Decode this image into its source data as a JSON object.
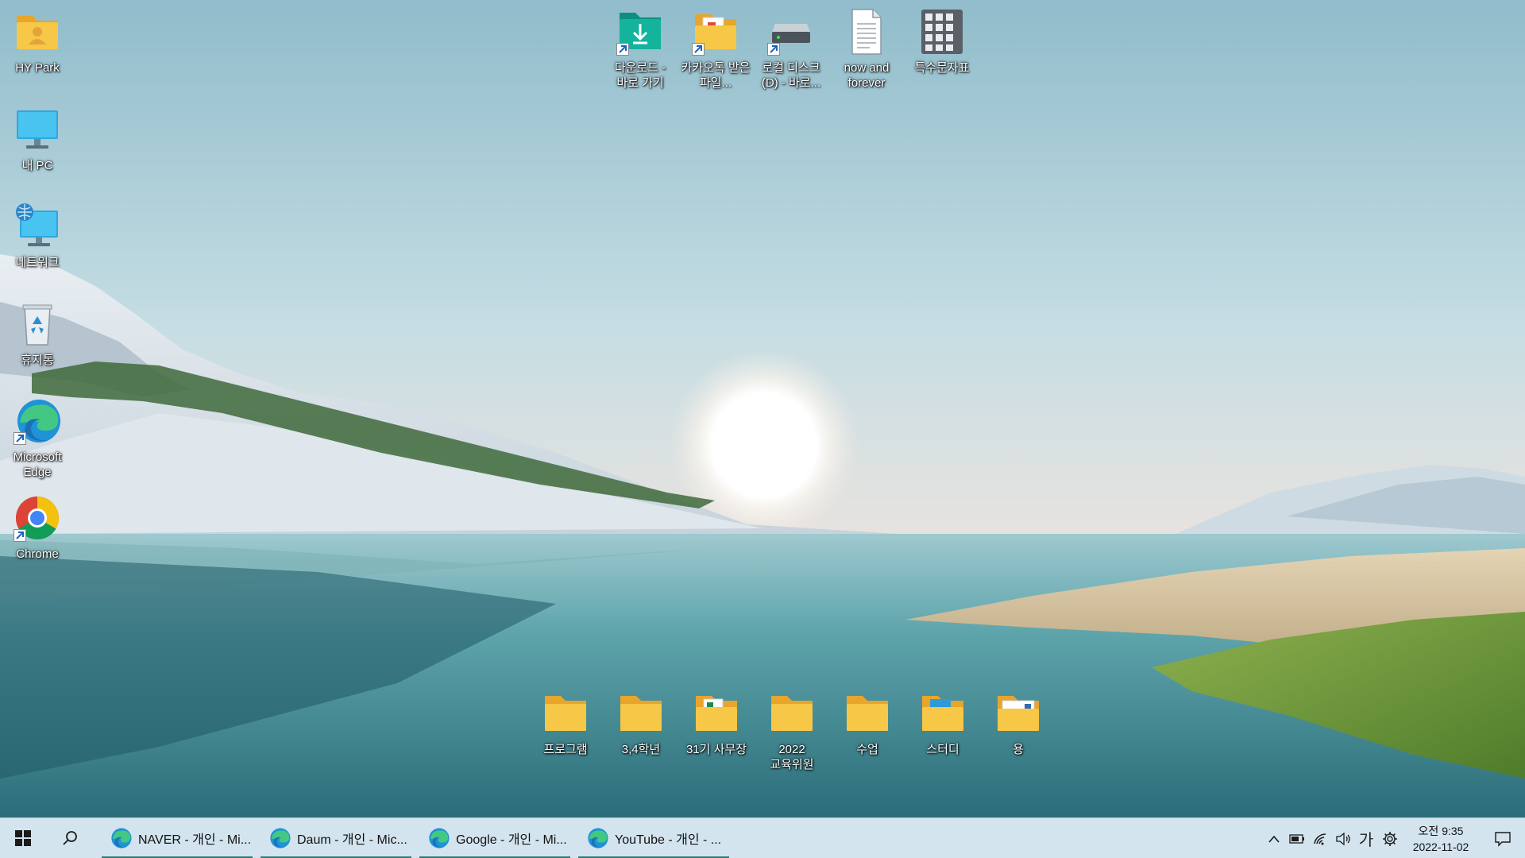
{
  "desktop": {
    "left_column": [
      {
        "name": "user-folder",
        "label": "HY Park",
        "icon": "user-folder-icon"
      },
      {
        "name": "this-pc",
        "label": "내 PC",
        "icon": "monitor-icon"
      },
      {
        "name": "network",
        "label": "네트워크",
        "icon": "network-icon"
      },
      {
        "name": "recycle-bin",
        "label": "휴지통",
        "icon": "recycle-bin-icon"
      },
      {
        "name": "edge",
        "label": "Microsoft Edge",
        "icon": "edge-icon"
      },
      {
        "name": "chrome",
        "label": "Chrome",
        "icon": "chrome-icon"
      }
    ],
    "top_row": [
      {
        "name": "downloads-shortcut",
        "label": "다운로드 - 바로 가기",
        "icon": "download-folder-icon"
      },
      {
        "name": "kakaotalk-folder-shortcut",
        "label": "카카오톡 받은 파일...",
        "icon": "folder-icon"
      },
      {
        "name": "local-disk-d-shortcut",
        "label": "로컬 디스크 (D) - 바로...",
        "icon": "drive-icon"
      },
      {
        "name": "now-and-forever-file",
        "label": "now and forever",
        "icon": "text-file-icon"
      },
      {
        "name": "special-chars-app",
        "label": "특수문자표",
        "icon": "grid-app-icon"
      }
    ],
    "bottom_row": [
      {
        "name": "program-folder",
        "label": "프로그램",
        "icon": "folder-icon"
      },
      {
        "name": "grade34-folder",
        "label": "3,4학년",
        "icon": "folder-icon"
      },
      {
        "name": "office31-folder",
        "label": "31기 사무장",
        "icon": "folder-icon"
      },
      {
        "name": "committee-folder",
        "label": "2022 교육위원",
        "icon": "folder-icon"
      },
      {
        "name": "class-folder",
        "label": "수업",
        "icon": "folder-icon"
      },
      {
        "name": "study-folder",
        "label": "스터디",
        "icon": "folder-icon"
      },
      {
        "name": "yong-folder",
        "label": "용",
        "icon": "folder-icon"
      }
    ]
  },
  "taskbar": {
    "tasks": [
      {
        "label": "NAVER - 개인 - Mi...",
        "icon": "edge-icon"
      },
      {
        "label": "Daum - 개인 - Mic...",
        "icon": "edge-icon"
      },
      {
        "label": "Google - 개인 - Mi...",
        "icon": "edge-icon"
      },
      {
        "label": "YouTube - 개인 - ...",
        "icon": "edge-icon"
      }
    ],
    "ime": "가",
    "time": "오전 9:35",
    "date": "2022-11-02"
  },
  "colors": {
    "taskbar_bg": "#d3e4ef",
    "task_underline": "#2f7a72",
    "folder_yellow": "#f7c748"
  }
}
